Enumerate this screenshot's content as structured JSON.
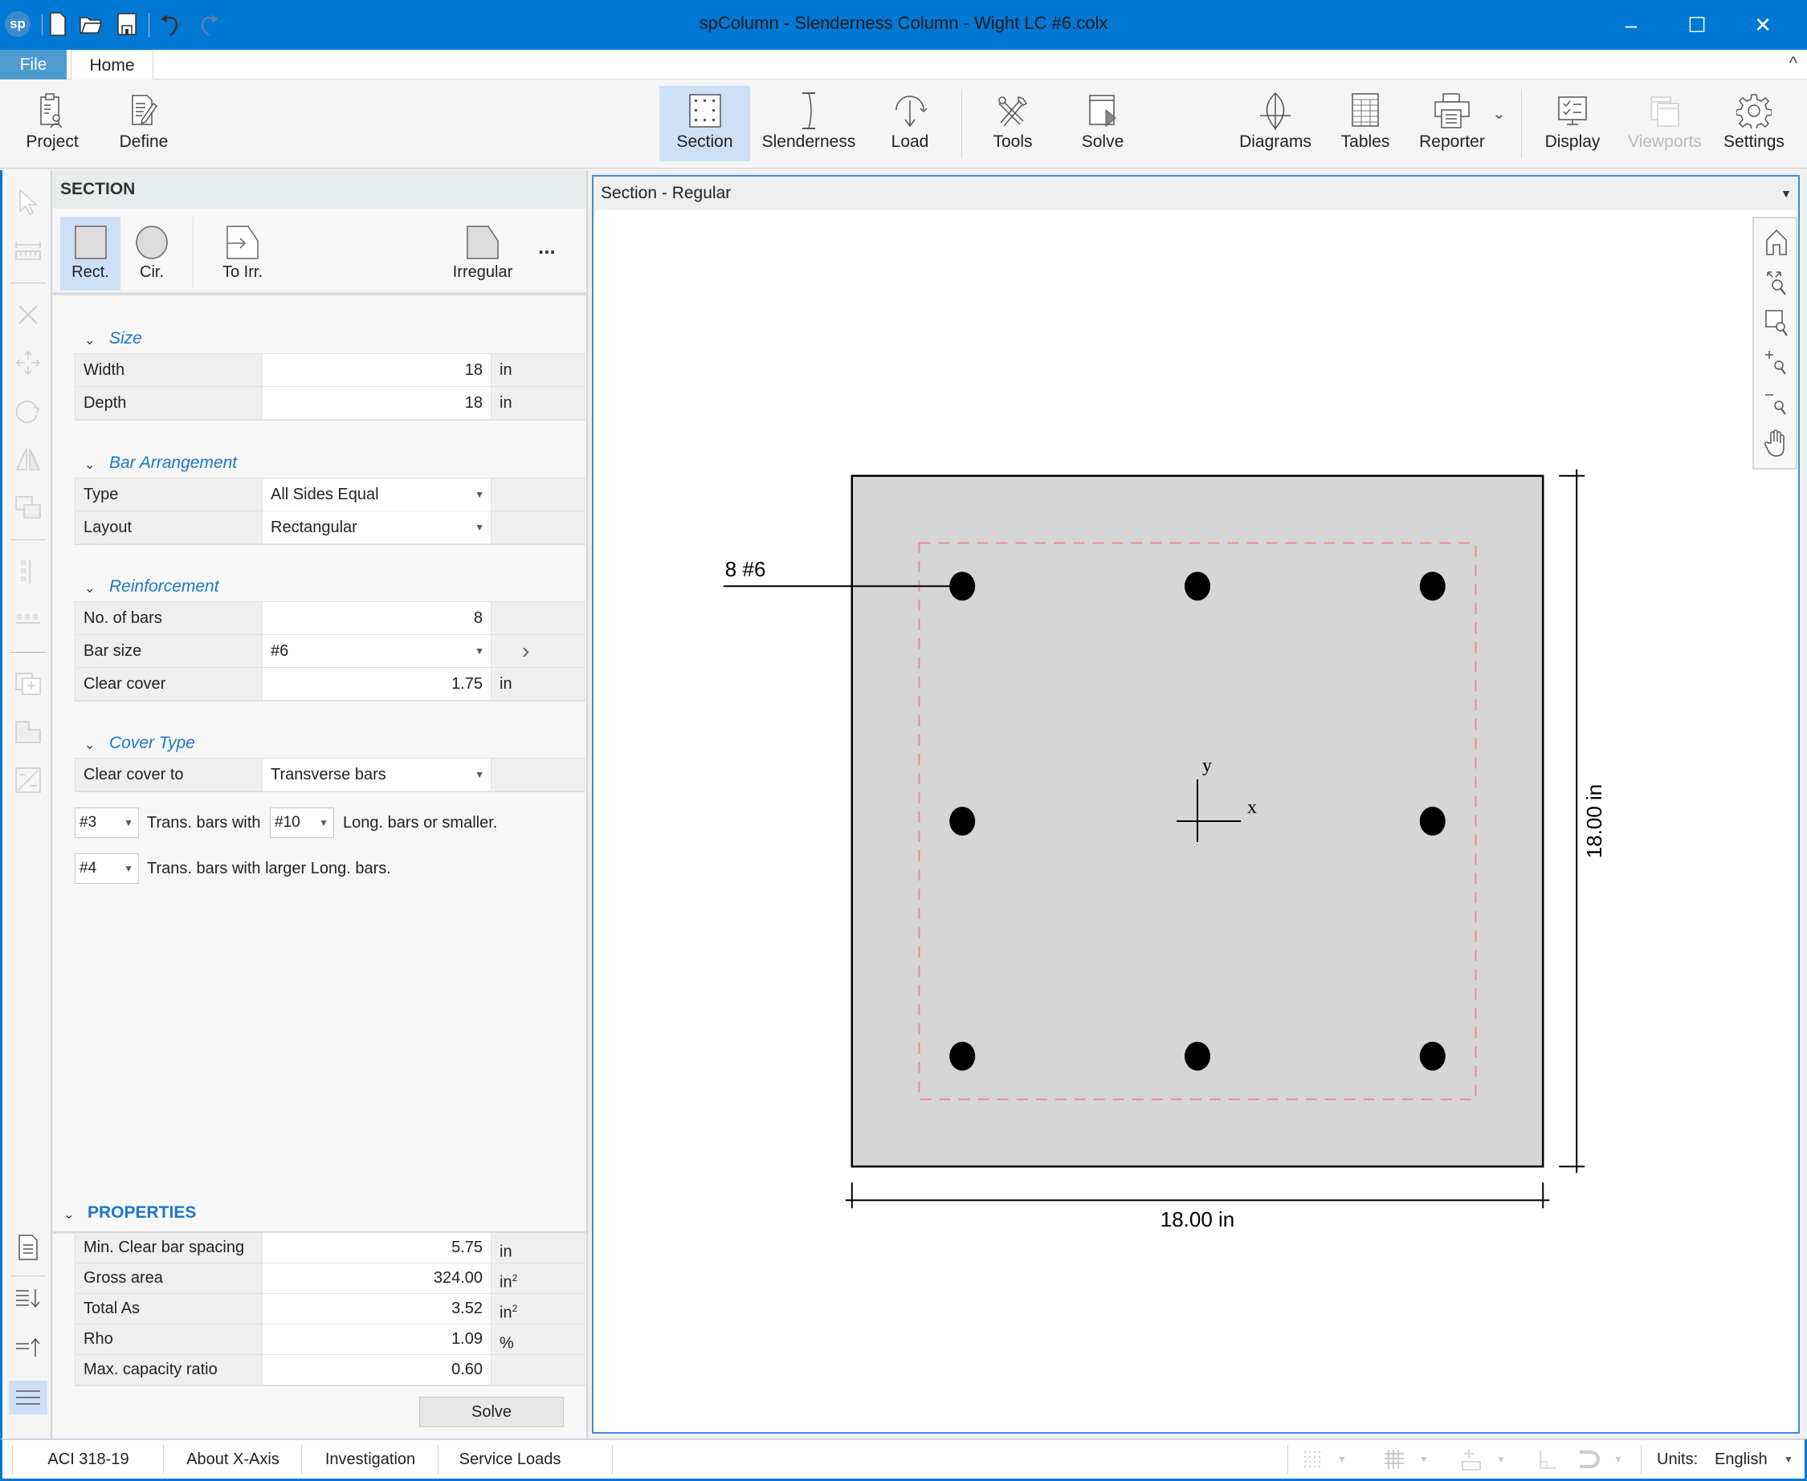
{
  "window": {
    "title": "spColumn - Slenderness Column - Wight LC #6.colx",
    "logo_text": "sp",
    "quick_access": [
      "new-file",
      "open-folder",
      "save",
      "undo",
      "redo"
    ],
    "controls": {
      "minimize": "–",
      "maximize": "☐",
      "close": "✕"
    }
  },
  "tabs": {
    "file": "File",
    "home": "Home",
    "collapse_glyph": "^"
  },
  "ribbon": {
    "project": "Project",
    "define": "Define",
    "section": "Section",
    "slenderness": "Slenderness",
    "load": "Load",
    "tools": "Tools",
    "solve": "Solve",
    "diagrams": "Diagrams",
    "tables": "Tables",
    "reporter": "Reporter",
    "reporter_dropdown": "⌄",
    "display": "Display",
    "viewports": "Viewports",
    "settings": "Settings",
    "active": "Section"
  },
  "left_toolbar": [
    "select",
    "measure",
    "delete",
    "move",
    "rotate",
    "mirror",
    "copy",
    "align-vertical",
    "align-horizontal",
    "add-region",
    "opening",
    "scale",
    "report",
    "expand-all",
    "collapse-all",
    "menu"
  ],
  "panel": {
    "header": "SECTION",
    "shapes": {
      "rect": "Rect.",
      "cir": "Cir.",
      "to_irr": "To Irr.",
      "irregular": "Irregular",
      "more": "..."
    },
    "size": {
      "title": "Size",
      "rows": [
        {
          "label": "Width",
          "value": "18",
          "unit": "in"
        },
        {
          "label": "Depth",
          "value": "18",
          "unit": "in"
        }
      ]
    },
    "bar_arrangement": {
      "title": "Bar Arrangement",
      "rows": [
        {
          "label": "Type",
          "value": "All Sides Equal"
        },
        {
          "label": "Layout",
          "value": "Rectangular"
        }
      ]
    },
    "reinforcement": {
      "title": "Reinforcement",
      "rows": [
        {
          "label": "No. of bars",
          "value": "8",
          "unit": ""
        },
        {
          "label": "Bar size",
          "value": "#6",
          "unit": "›"
        },
        {
          "label": "Clear cover",
          "value": "1.75",
          "unit": "in"
        }
      ]
    },
    "cover_type": {
      "title": "Cover Type",
      "clear_cover_to_label": "Clear cover to",
      "clear_cover_to_value": "Transverse bars",
      "rule1": {
        "trans_bar": "#3",
        "text1": "Trans. bars with",
        "long_bar": "#10",
        "text2": "Long. bars or smaller."
      },
      "rule2": {
        "trans_bar": "#4",
        "text": "Trans. bars with larger Long. bars."
      }
    },
    "properties": {
      "title": "PROPERTIES",
      "rows": [
        {
          "label": "Min. Clear bar spacing",
          "value": "5.75",
          "unit": "in",
          "sup": ""
        },
        {
          "label": "Gross area",
          "value": "324.00",
          "unit": "in",
          "sup": "2"
        },
        {
          "label": "Total As",
          "value": "3.52",
          "unit": "in",
          "sup": "2"
        },
        {
          "label": "Rho",
          "value": "1.09",
          "unit": "%",
          "sup": ""
        },
        {
          "label": "Max. capacity ratio",
          "value": "0.60",
          "unit": "",
          "sup": ""
        }
      ],
      "solve_label": "Solve"
    }
  },
  "view": {
    "title": "Section - Regular",
    "nav_tools": [
      "home",
      "zoom-extents",
      "zoom-window",
      "zoom-in",
      "zoom-out",
      "pan"
    ],
    "section": {
      "width_in": 18,
      "depth_in": 18,
      "clear_cover_in": 1.75,
      "bar_label": "8 #6",
      "bars": [
        {
          "x": -6.125,
          "y": 6.125
        },
        {
          "x": 0,
          "y": 6.125
        },
        {
          "x": 6.125,
          "y": 6.125
        },
        {
          "x": -6.125,
          "y": 0
        },
        {
          "x": 6.125,
          "y": 0
        },
        {
          "x": -6.125,
          "y": -6.125
        },
        {
          "x": 0,
          "y": -6.125
        },
        {
          "x": 6.125,
          "y": -6.125
        }
      ],
      "axis_x_label": "x",
      "axis_y_label": "y",
      "dim_horizontal": "18.00 in",
      "dim_vertical": "18.00 in",
      "colors": {
        "concrete": "#d6d6d6",
        "outline": "#000000",
        "cover_line": "#f08c8c",
        "bar": "#000000"
      }
    }
  },
  "status": {
    "code": "ACI 318-19",
    "axis": "About X-Axis",
    "mode": "Investigation",
    "loads": "Service Loads",
    "units_label": "Units:",
    "units_value": "English"
  }
}
